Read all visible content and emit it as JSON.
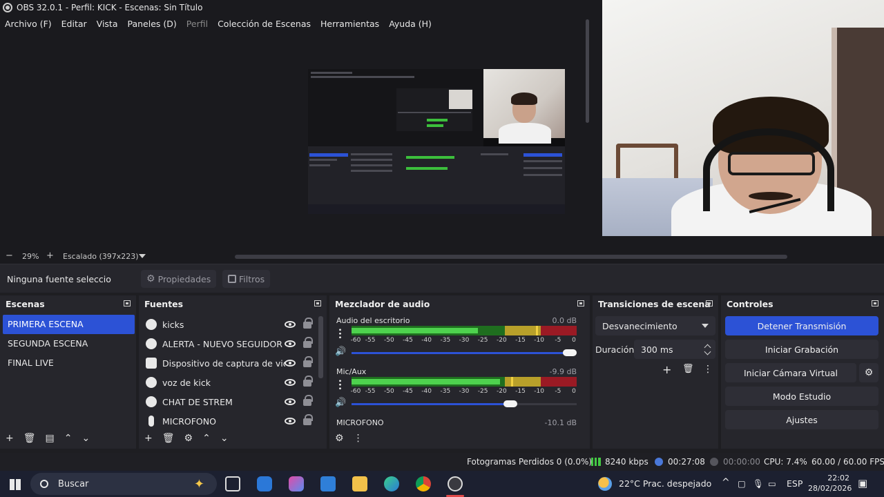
{
  "window": {
    "title": "OBS 32.0.1 - Perfil: KICK - Escenas: Sin Título"
  },
  "menu": [
    "Archivo (F)",
    "Editar",
    "Vista",
    "Paneles (D)",
    "Perfil",
    "Colección de Escenas",
    "Herramientas",
    "Ayuda (H)"
  ],
  "zoom": {
    "value": "29%",
    "scaling": "Escalado (397x223)"
  },
  "source_toolbar": {
    "no_selection": "Ninguna fuente seleccionada",
    "properties": "Propiedades",
    "filters": "Filtros"
  },
  "scenes": {
    "title": "Escenas",
    "items": [
      "PRIMERA ESCENA",
      "SEGUNDA ESCENA",
      "FINAL LIVE"
    ],
    "selected_index": 0
  },
  "sources": {
    "title": "Fuentes",
    "items": [
      {
        "label": "kicks",
        "icon": "browser-icon"
      },
      {
        "label": "ALERTA - NUEVO SEGUIDOR",
        "icon": "browser-icon"
      },
      {
        "label": "Dispositivo de captura de video",
        "icon": "camera-icon"
      },
      {
        "label": "voz de kick",
        "icon": "browser-icon"
      },
      {
        "label": "CHAT DE STREM",
        "icon": "browser-icon"
      },
      {
        "label": "MICROFONO",
        "icon": "microphone-icon"
      }
    ]
  },
  "mixer": {
    "title": "Mezclador de audio",
    "ticks": [
      "-60",
      "-55",
      "-50",
      "-45",
      "-40",
      "-35",
      "-30",
      "-25",
      "-20",
      "-15",
      "-10",
      "-5",
      "0"
    ],
    "channels": [
      {
        "name": "Audio del escritorio",
        "db": "0.0 dB",
        "level": 0.56,
        "peak": 0.82,
        "volume": 1.0
      },
      {
        "name": "Mic/Aux",
        "db": "-9.9 dB",
        "level": 0.66,
        "peak": 0.71,
        "volume": 0.72
      },
      {
        "name": "MICROFONO",
        "db": "-10.1 dB"
      }
    ]
  },
  "transitions": {
    "title": "Transiciones de escena",
    "selected": "Desvanecimiento",
    "duration_label": "Duración",
    "duration_value": "300 ms"
  },
  "controls": {
    "title": "Controles",
    "stop_stream": "Detener Transmisión",
    "start_recording": "Iniciar Grabación",
    "start_virtual_cam": "Iniciar Cámara Virtual",
    "studio_mode": "Modo Estudio",
    "settings": "Ajustes"
  },
  "status": {
    "dropped_frames": "Fotogramas Perdidos 0 (0.0%)",
    "bitrate": "8240 kbps",
    "stream_time": "00:27:08",
    "rec_time": "00:00:00",
    "cpu": "CPU: 7.4%",
    "fps": "60.00 / 60.00 FPS"
  },
  "taskbar": {
    "search_placeholder": "Buscar",
    "weather": "22°C  Prac. despejado",
    "language": "ESP",
    "time": "22:02",
    "date": "28/02/2026"
  },
  "colors": {
    "accent": "#2c52d6",
    "meter_green": "#4ed24e",
    "meter_yellow": "#b8a02a",
    "meter_red": "#9a1a24"
  }
}
